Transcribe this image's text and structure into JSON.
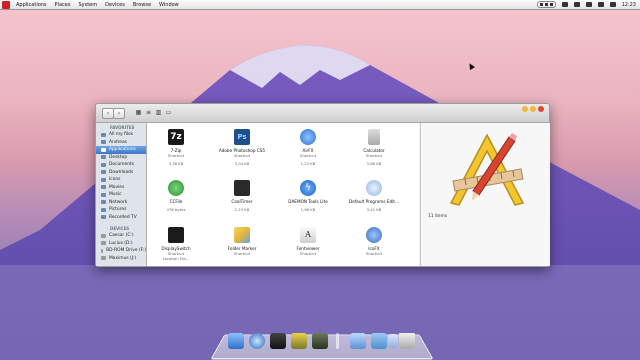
{
  "menubar": {
    "menus": [
      "Applications",
      "Places",
      "System",
      "Devices",
      "Browse",
      "Window"
    ],
    "clock": "12:23"
  },
  "sidebar": {
    "sections": [
      {
        "heading": "FAVORITES",
        "items": [
          {
            "label": "All my files",
            "selected": false
          },
          {
            "label": "Andreas",
            "selected": false
          },
          {
            "label": "Applications",
            "selected": true
          },
          {
            "label": "Desktop",
            "selected": false
          },
          {
            "label": "Documents",
            "selected": false
          },
          {
            "label": "Downloads",
            "selected": false
          },
          {
            "label": "Icons",
            "selected": false
          },
          {
            "label": "Movies",
            "selected": false
          },
          {
            "label": "Music",
            "selected": false
          },
          {
            "label": "Network",
            "selected": false
          },
          {
            "label": "Pictures",
            "selected": false
          },
          {
            "label": "Recorded TV",
            "selected": false
          }
        ]
      },
      {
        "heading": "DEVICES",
        "items": [
          {
            "label": "Caesar (C:)",
            "selected": false
          },
          {
            "label": "Lucius (D:)",
            "selected": false
          },
          {
            "label": "BD-ROM Drive (F:)",
            "selected": false
          },
          {
            "label": "Maximus (J:)",
            "selected": false
          }
        ]
      }
    ]
  },
  "files": [
    {
      "name": "7-Zip",
      "sub": "Shortcut",
      "size": "3,36 KB",
      "icon": "7zip-icon",
      "color": "#1a1a1a"
    },
    {
      "name": "Adobe Photoshop CS5",
      "sub": "Shortcut",
      "size": "3,04 KB",
      "icon": "photoshop-icon",
      "color": "#1d4f8f"
    },
    {
      "name": "AirFX",
      "sub": "Shortcut",
      "size": "1,23 KB",
      "icon": "airfx-icon",
      "color": "#2f6fd0"
    },
    {
      "name": "Calculator",
      "sub": "Shortcut",
      "size": "3,88 KB",
      "icon": "calculator-icon",
      "color": "#b9b9b9"
    },
    {
      "name": "CCFile",
      "sub": "Shortcut",
      "size": "476 bytes",
      "icon": "ccfile-icon",
      "color": "#3aa63a"
    },
    {
      "name": "CoolTimer",
      "sub": "Shortcut",
      "size": "2,23 KB",
      "icon": "cooltimer-icon",
      "color": "#2a2a2a"
    },
    {
      "name": "DAEMON Tools Lite",
      "sub": "Shortcut",
      "size": "1,96 KB",
      "icon": "daemon-tools-icon",
      "color": "#1e62c8"
    },
    {
      "name": "Default Programs Edit...",
      "sub": "Shortcut",
      "size": "3,41 KB",
      "icon": "default-programs-icon",
      "color": "#8fb6e0"
    },
    {
      "name": "DisplaySwitch",
      "sub": "Shortcut",
      "size": "Location Dis...",
      "icon": "displayswitch-icon",
      "color": "#1b1b1b"
    },
    {
      "name": "Folder Marker",
      "sub": "Shortcut",
      "size": "",
      "icon": "folder-marker-icon",
      "color": "#e7b43a"
    },
    {
      "name": "Fontviewer",
      "sub": "Shortcut",
      "size": "",
      "icon": "fontviewer-icon",
      "color": "#dcdcdc"
    },
    {
      "name": "IcoFX",
      "sub": "Shortcut",
      "size": "",
      "icon": "icofx-icon",
      "color": "#3a6fc4"
    }
  ],
  "preview": {
    "count": "11 items",
    "icon": "applications-folder-icon"
  },
  "dock": {
    "items": [
      "finder-icon",
      "safari-icon",
      "app-icon",
      "puzzle-icon",
      "game-icon",
      "display-icon",
      "folder-icon",
      "downloads-icon",
      "trash-icon"
    ]
  }
}
